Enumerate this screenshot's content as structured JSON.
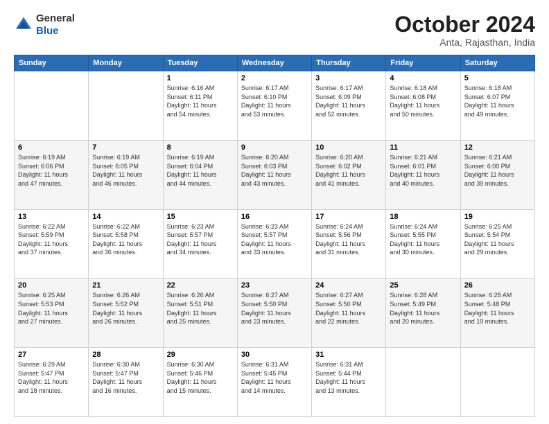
{
  "logo": {
    "general": "General",
    "blue": "Blue"
  },
  "header": {
    "month": "October 2024",
    "location": "Anta, Rajasthan, India"
  },
  "days_of_week": [
    "Sunday",
    "Monday",
    "Tuesday",
    "Wednesday",
    "Thursday",
    "Friday",
    "Saturday"
  ],
  "weeks": [
    [
      {
        "day": "",
        "info": ""
      },
      {
        "day": "",
        "info": ""
      },
      {
        "day": "1",
        "info": "Sunrise: 6:16 AM\nSunset: 6:11 PM\nDaylight: 11 hours\nand 54 minutes."
      },
      {
        "day": "2",
        "info": "Sunrise: 6:17 AM\nSunset: 6:10 PM\nDaylight: 11 hours\nand 53 minutes."
      },
      {
        "day": "3",
        "info": "Sunrise: 6:17 AM\nSunset: 6:09 PM\nDaylight: 11 hours\nand 52 minutes."
      },
      {
        "day": "4",
        "info": "Sunrise: 6:18 AM\nSunset: 6:08 PM\nDaylight: 11 hours\nand 50 minutes."
      },
      {
        "day": "5",
        "info": "Sunrise: 6:18 AM\nSunset: 6:07 PM\nDaylight: 11 hours\nand 49 minutes."
      }
    ],
    [
      {
        "day": "6",
        "info": "Sunrise: 6:19 AM\nSunset: 6:06 PM\nDaylight: 11 hours\nand 47 minutes."
      },
      {
        "day": "7",
        "info": "Sunrise: 6:19 AM\nSunset: 6:05 PM\nDaylight: 11 hours\nand 46 minutes."
      },
      {
        "day": "8",
        "info": "Sunrise: 6:19 AM\nSunset: 6:04 PM\nDaylight: 11 hours\nand 44 minutes."
      },
      {
        "day": "9",
        "info": "Sunrise: 6:20 AM\nSunset: 6:03 PM\nDaylight: 11 hours\nand 43 minutes."
      },
      {
        "day": "10",
        "info": "Sunrise: 6:20 AM\nSunset: 6:02 PM\nDaylight: 11 hours\nand 41 minutes."
      },
      {
        "day": "11",
        "info": "Sunrise: 6:21 AM\nSunset: 6:01 PM\nDaylight: 11 hours\nand 40 minutes."
      },
      {
        "day": "12",
        "info": "Sunrise: 6:21 AM\nSunset: 6:00 PM\nDaylight: 11 hours\nand 39 minutes."
      }
    ],
    [
      {
        "day": "13",
        "info": "Sunrise: 6:22 AM\nSunset: 5:59 PM\nDaylight: 11 hours\nand 37 minutes."
      },
      {
        "day": "14",
        "info": "Sunrise: 6:22 AM\nSunset: 5:58 PM\nDaylight: 11 hours\nand 36 minutes."
      },
      {
        "day": "15",
        "info": "Sunrise: 6:23 AM\nSunset: 5:57 PM\nDaylight: 11 hours\nand 34 minutes."
      },
      {
        "day": "16",
        "info": "Sunrise: 6:23 AM\nSunset: 5:57 PM\nDaylight: 11 hours\nand 33 minutes."
      },
      {
        "day": "17",
        "info": "Sunrise: 6:24 AM\nSunset: 5:56 PM\nDaylight: 11 hours\nand 31 minutes."
      },
      {
        "day": "18",
        "info": "Sunrise: 6:24 AM\nSunset: 5:55 PM\nDaylight: 11 hours\nand 30 minutes."
      },
      {
        "day": "19",
        "info": "Sunrise: 6:25 AM\nSunset: 5:54 PM\nDaylight: 11 hours\nand 29 minutes."
      }
    ],
    [
      {
        "day": "20",
        "info": "Sunrise: 6:25 AM\nSunset: 5:53 PM\nDaylight: 11 hours\nand 27 minutes."
      },
      {
        "day": "21",
        "info": "Sunrise: 6:26 AM\nSunset: 5:52 PM\nDaylight: 11 hours\nand 26 minutes."
      },
      {
        "day": "22",
        "info": "Sunrise: 6:26 AM\nSunset: 5:51 PM\nDaylight: 11 hours\nand 25 minutes."
      },
      {
        "day": "23",
        "info": "Sunrise: 6:27 AM\nSunset: 5:50 PM\nDaylight: 11 hours\nand 23 minutes."
      },
      {
        "day": "24",
        "info": "Sunrise: 6:27 AM\nSunset: 5:50 PM\nDaylight: 11 hours\nand 22 minutes."
      },
      {
        "day": "25",
        "info": "Sunrise: 6:28 AM\nSunset: 5:49 PM\nDaylight: 11 hours\nand 20 minutes."
      },
      {
        "day": "26",
        "info": "Sunrise: 6:28 AM\nSunset: 5:48 PM\nDaylight: 11 hours\nand 19 minutes."
      }
    ],
    [
      {
        "day": "27",
        "info": "Sunrise: 6:29 AM\nSunset: 5:47 PM\nDaylight: 11 hours\nand 18 minutes."
      },
      {
        "day": "28",
        "info": "Sunrise: 6:30 AM\nSunset: 5:47 PM\nDaylight: 11 hours\nand 16 minutes."
      },
      {
        "day": "29",
        "info": "Sunrise: 6:30 AM\nSunset: 5:46 PM\nDaylight: 11 hours\nand 15 minutes."
      },
      {
        "day": "30",
        "info": "Sunrise: 6:31 AM\nSunset: 5:45 PM\nDaylight: 11 hours\nand 14 minutes."
      },
      {
        "day": "31",
        "info": "Sunrise: 6:31 AM\nSunset: 5:44 PM\nDaylight: 11 hours\nand 13 minutes."
      },
      {
        "day": "",
        "info": ""
      },
      {
        "day": "",
        "info": ""
      }
    ]
  ]
}
